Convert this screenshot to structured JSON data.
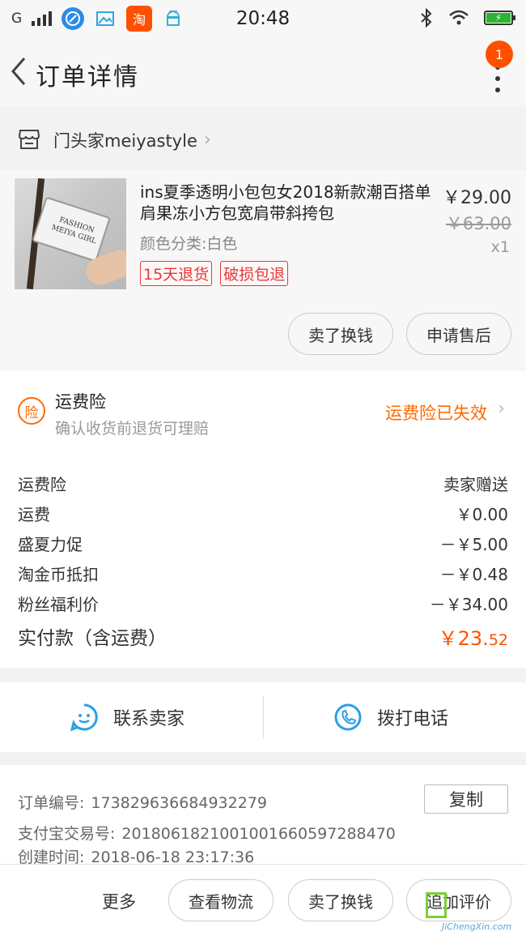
{
  "status_bar": {
    "carrier": "G",
    "time": "20:48",
    "apps": [
      {
        "icon": "browser-icon",
        "color": "#2b8be6"
      },
      {
        "icon": "gallery-icon",
        "color": "#2ea7e0"
      },
      {
        "icon": "taobao-icon",
        "label": "淘",
        "color": "#ff5000"
      },
      {
        "icon": "android-icon",
        "color": "#36b0d8"
      }
    ],
    "battery_level": 1.0,
    "battery_color": "#2cb431"
  },
  "header": {
    "title": "订单详情",
    "badge_count": "1",
    "badge_color": "#ff5000"
  },
  "shop": {
    "name": "门头家meiyastyle"
  },
  "product": {
    "title": "ins夏季透明小包包女2018新款潮百搭单肩果冻小方包宽肩带斜挎包",
    "image_text": "FASHION MEIYA GIRL",
    "spec": "颜色分类:白色",
    "price": "￥29.00",
    "original_price": "￥63.00",
    "quantity": "x1",
    "tags": [
      "15天退货",
      "破损包退"
    ],
    "buttons": [
      "卖了换钱",
      "申请售后"
    ]
  },
  "insurance": {
    "icon_label": "险",
    "title": "运费险",
    "subtitle": "确认收货前退货可理赔",
    "status": "运费险已失效"
  },
  "fees": {
    "rows": [
      {
        "label": "运费险",
        "value": "卖家赠送"
      },
      {
        "label": "运费",
        "value": "￥0.00"
      },
      {
        "label": "盛夏力促",
        "value": "－￥5.00"
      },
      {
        "label": "淘金币抵扣",
        "value": "－￥0.48"
      },
      {
        "label": "粉丝福利价",
        "value": "－￥34.00"
      }
    ],
    "total_label": "实付款（含运费）",
    "total_currency": "￥",
    "total_integer": "23.",
    "total_cents": "52",
    "accent_color": "#ff5000"
  },
  "contact": {
    "seller": "联系卖家",
    "phone": "拨打电话"
  },
  "order_info": {
    "order_no_label": "订单编号:",
    "order_no": "173829636684932279",
    "copy_label": "复制",
    "alipay_label": "支付宝交易号:",
    "alipay_no": "2018061821001001660597288470",
    "created_label": "创建时间:",
    "created_time": "2018-06-18 23:17:36"
  },
  "bottom_bar": {
    "more": "更多",
    "buttons": [
      "查看物流",
      "卖了换钱",
      "追加评价"
    ]
  },
  "watermark": {
    "text": "JiChengXin.com"
  }
}
